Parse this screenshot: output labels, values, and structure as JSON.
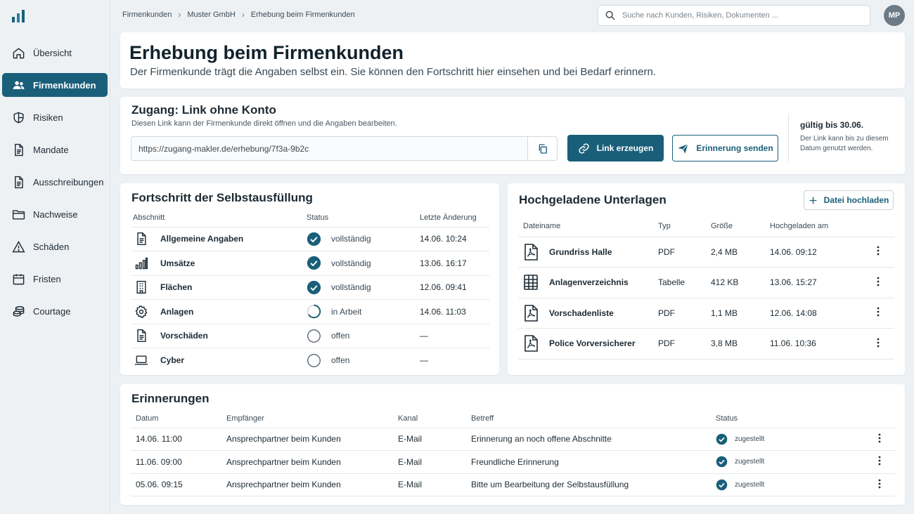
{
  "nav": {
    "items": [
      {
        "label": "Übersicht",
        "icon": "home-icon"
      },
      {
        "label": "Firmenkunden",
        "icon": "users-icon",
        "active": true
      },
      {
        "label": "Risiken",
        "icon": "shield-icon"
      },
      {
        "label": "Mandate",
        "icon": "document-icon"
      },
      {
        "label": "Ausschreibungen",
        "icon": "document-icon"
      },
      {
        "label": "Nachweise",
        "icon": "folder-icon"
      },
      {
        "label": "Schäden",
        "icon": "warning-icon"
      },
      {
        "label": "Fristen",
        "icon": "calendar-icon"
      },
      {
        "label": "Courtage",
        "icon": "coins-icon"
      }
    ]
  },
  "breadcrumb": [
    "Firmenkunden",
    "Muster GmbH",
    "Erhebung beim Firmenkunden"
  ],
  "search": {
    "placeholder": "Suche nach Kunden, Risiken, Dokumenten ..."
  },
  "user": {
    "initials": "MP"
  },
  "header": {
    "title": "Erhebung beim Firmenkunden",
    "subtitle": "Der Firmenkunde trägt die Angaben selbst ein. Sie können den Fortschritt hier einsehen und bei Bedarf erinnern."
  },
  "access": {
    "title": "Zugang: Link ohne Konto",
    "description": "Diesen Link kann der Firmenkunde direkt öffnen und die Angaben bearbeiten.",
    "url": "https://zugang-makler.de/erhebung/7f3a-9b2c",
    "generate_label": "Link erzeugen",
    "remind_label": "Erinnerung senden",
    "validity_title": "gültig bis 30.06.",
    "validity_text": "Der Link kann bis zu diesem Datum genutzt werden."
  },
  "progress": {
    "title": "Fortschritt der Selbstausfüllung",
    "columns": [
      "Abschnitt",
      "Status",
      "Letzte Änderung"
    ],
    "rows": [
      {
        "section": "Allgemeine Angaben",
        "icon": "document-icon",
        "status": "vollständig",
        "state": "done",
        "changed": "14.06.  10:24"
      },
      {
        "section": "Umsätze",
        "icon": "bar-chart-icon",
        "status": "vollständig",
        "state": "done",
        "changed": "13.06.  16:17"
      },
      {
        "section": "Flächen",
        "icon": "building-icon",
        "status": "vollständig",
        "state": "done",
        "changed": "12.06.  09:41"
      },
      {
        "section": "Anlagen",
        "icon": "gear-icon",
        "status": "in Arbeit",
        "state": "progress",
        "changed": "14.06.  11:03"
      },
      {
        "section": "Vorschäden",
        "icon": "document-icon",
        "status": "offen",
        "state": "open",
        "changed": "—"
      },
      {
        "section": "Cyber",
        "icon": "laptop-icon",
        "status": "offen",
        "state": "open",
        "changed": "—"
      }
    ]
  },
  "documents": {
    "title": "Hochgeladene Unterlagen",
    "upload_label": "Datei hochladen",
    "columns": [
      "Dateiname",
      "Typ",
      "Größe",
      "Hochgeladen am"
    ],
    "rows": [
      {
        "name": "Grundriss Halle",
        "icon": "pdf-file-icon",
        "type": "PDF",
        "size": "2,4 MB",
        "uploaded": "14.06.  09:12"
      },
      {
        "name": "Anlagenverzeichnis",
        "icon": "spreadsheet-icon",
        "type": "Tabelle",
        "size": "412 KB",
        "uploaded": "13.06.  15:27"
      },
      {
        "name": "Vorschadenliste",
        "icon": "pdf-file-icon",
        "type": "PDF",
        "size": "1,1 MB",
        "uploaded": "12.06.  14:08"
      },
      {
        "name": "Police Vorversicherer",
        "icon": "pdf-file-icon",
        "type": "PDF",
        "size": "3,8 MB",
        "uploaded": "11.06.  10:36"
      }
    ]
  },
  "reminders": {
    "title": "Erinnerungen",
    "columns": [
      "Datum",
      "Empfänger",
      "Kanal",
      "Betreff",
      "Status"
    ],
    "rows": [
      {
        "date": "14.06.  11:00",
        "recipient": "Ansprechpartner beim Kunden",
        "channel": "E-Mail",
        "subject": "Erinnerung an noch offene Abschnitte",
        "status": "zugestellt"
      },
      {
        "date": "11.06.  09:00",
        "recipient": "Ansprechpartner beim Kunden",
        "channel": "E-Mail",
        "subject": "Freundliche Erinnerung",
        "status": "zugestellt"
      },
      {
        "date": "05.06.  09:15",
        "recipient": "Ansprechpartner beim Kunden",
        "channel": "E-Mail",
        "subject": "Bitte um Bearbeitung der Selbstausfüllung",
        "status": "zugestellt"
      }
    ]
  },
  "colors": {
    "primary": "#1a5f7a",
    "background": "#eef1f4"
  }
}
